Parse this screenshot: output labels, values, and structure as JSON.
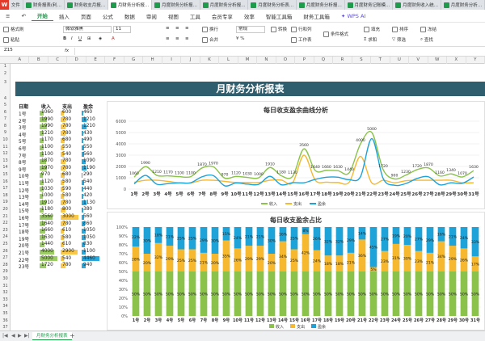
{
  "tabs": [
    {
      "label": "文件"
    },
    {
      "label": "财务报表(利…"
    },
    {
      "label": "财务收支月报…"
    },
    {
      "label": "月财务分析报…"
    },
    {
      "label": "月度财务分析报…"
    },
    {
      "label": "月度财务分析报…"
    },
    {
      "label": "月度财务分析表…"
    },
    {
      "label": "月度财务分析报…"
    },
    {
      "label": "月度财务记账模…"
    },
    {
      "label": "月度财务收入统…"
    },
    {
      "label": "月度财务分析…"
    }
  ],
  "menu": [
    "开始",
    "插入",
    "页面",
    "公式",
    "数据",
    "审阅",
    "视图",
    "工具",
    "会员专享",
    "效率",
    "智能工具箱",
    "财务工具箱"
  ],
  "wps_ai": "WPS AI",
  "ribbon": {
    "format_painter": "格式刷",
    "paste": "粘贴",
    "font_name": "微软雅黑",
    "font_size": "11",
    "wrap": "换行",
    "merge": "合并",
    "number_format": "常规",
    "convert": "转换",
    "row_col": "行和列",
    "worksheet": "工作表",
    "cond_format": "条件格式",
    "fill": "填充",
    "sort": "排序",
    "freeze": "冻结",
    "sum": "求和",
    "filter": "筛选",
    "find": "查找"
  },
  "formula_bar": {
    "cell_ref": "Z15",
    "fx": "fx"
  },
  "columns": [
    "A",
    "B",
    "C",
    "D",
    "E",
    "F",
    "G",
    "H",
    "I",
    "J",
    "K",
    "L",
    "M",
    "N",
    "O",
    "P",
    "Q",
    "R",
    "S",
    "T",
    "U",
    "V",
    "W",
    "X",
    "Y"
  ],
  "rows": [
    "1",
    "2",
    "3",
    "4",
    "5",
    "6",
    "7",
    "8",
    "9",
    "10",
    "11",
    "12",
    "13",
    "14",
    "15",
    "16",
    "17",
    "18",
    "19",
    "20",
    "21",
    "22",
    "23",
    "24",
    "25",
    "26",
    "27",
    "28",
    "29",
    "30",
    "31",
    "32",
    "33",
    "34",
    "35",
    "36",
    "37"
  ],
  "report_title": "月财务分析报表",
  "table": {
    "headers": [
      "日期",
      "收入",
      "支出",
      "盈余"
    ],
    "rows": [
      {
        "date": "1号",
        "income": 1060,
        "expense": 600,
        "surplus": 460
      },
      {
        "date": "2号",
        "income": 1990,
        "expense": 780,
        "surplus": 1210
      },
      {
        "date": "3号",
        "income": 1990,
        "expense": 780,
        "surplus": 1210
      },
      {
        "date": "4号",
        "income": 1210,
        "expense": 780,
        "surplus": 430
      },
      {
        "date": "5号",
        "income": 1170,
        "expense": 680,
        "surplus": 490
      },
      {
        "date": "6号",
        "income": 1100,
        "expense": 550,
        "surplus": 550
      },
      {
        "date": "7号",
        "income": 1100,
        "expense": 540,
        "surplus": 560
      },
      {
        "date": "8号",
        "income": 1870,
        "expense": 780,
        "surplus": 1090
      },
      {
        "date": "9号",
        "income": 1970,
        "expense": 780,
        "surplus": 1190
      },
      {
        "date": "10号",
        "income": 970,
        "expense": 680,
        "surplus": 290
      },
      {
        "date": "11号",
        "income": 1120,
        "expense": 580,
        "surplus": 540
      },
      {
        "date": "12号",
        "income": 1030,
        "expense": 590,
        "surplus": 440
      },
      {
        "date": "13号",
        "income": 1000,
        "expense": 580,
        "surplus": 420
      },
      {
        "date": "14号",
        "income": 1910,
        "expense": 780,
        "surplus": 1130
      },
      {
        "date": "15号",
        "income": 1180,
        "expense": 800,
        "surplus": 380
      },
      {
        "date": "16号",
        "income": 3560,
        "expense": 3000,
        "surplus": 560
      },
      {
        "date": "17号",
        "income": 1640,
        "expense": 780,
        "surplus": 860
      },
      {
        "date": "18号",
        "income": 1660,
        "expense": 610,
        "surplus": 1050
      },
      {
        "date": "19号",
        "income": 1630,
        "expense": 580,
        "surplus": 1050
      },
      {
        "date": "20号",
        "income": 1440,
        "expense": 610,
        "surplus": 830
      },
      {
        "date": "21号",
        "income": 4000,
        "expense": 2900,
        "surplus": 1100
      },
      {
        "date": "22号",
        "income": 5000,
        "expense": 540,
        "surplus": 4460
      },
      {
        "date": "23号",
        "income": 1720,
        "expense": 780,
        "surplus": 940
      }
    ]
  },
  "chart_data": [
    {
      "type": "line",
      "title": "每日收支盈余曲线分析",
      "categories": [
        "1号",
        "2号",
        "3号",
        "4号",
        "5号",
        "6号",
        "7号",
        "8号",
        "9号",
        "10号",
        "11号",
        "12号",
        "13号",
        "14号",
        "15号",
        "16号",
        "17号",
        "18号",
        "19号",
        "20号",
        "21号",
        "22号",
        "23号",
        "24号",
        "25号",
        "26号",
        "27号",
        "28号",
        "29号",
        "30号",
        "31号"
      ],
      "series": [
        {
          "name": "收入",
          "color": "#8bc34a",
          "values": [
            1060,
            1990,
            1210,
            1170,
            1100,
            1100,
            1870,
            1970,
            970,
            1120,
            1030,
            1000,
            1910,
            1180,
            1130,
            3560,
            1640,
            1660,
            1630,
            1440,
            4000,
            5000,
            1720,
            900,
            1230,
            1720,
            1870,
            1160,
            1340,
            1070,
            1630
          ]
        },
        {
          "name": "支出",
          "color": "#f5b82e",
          "values": [
            600,
            780,
            780,
            680,
            550,
            540,
            780,
            780,
            680,
            580,
            590,
            580,
            780,
            800,
            560,
            3000,
            780,
            610,
            580,
            610,
            2900,
            540,
            780,
            560,
            740,
            780,
            780,
            780,
            780,
            560,
            560
          ]
        },
        {
          "name": "盈余",
          "color": "#1ea3d8",
          "values": [
            460,
            1210,
            430,
            490,
            550,
            560,
            1090,
            1190,
            290,
            540,
            440,
            420,
            1130,
            380,
            570,
            560,
            860,
            1050,
            1050,
            830,
            1100,
            4460,
            940,
            340,
            490,
            940,
            1090,
            380,
            560,
            510,
            1070
          ]
        }
      ],
      "point_labels": [
        1060,
        1990,
        1210,
        1170,
        1100,
        1100,
        1870,
        1970,
        970,
        1120,
        1030,
        1000,
        1910,
        1180,
        1130,
        3560,
        1640,
        1660,
        1630,
        1440,
        4000,
        5000,
        1720,
        900,
        1230,
        1720,
        1870,
        1160,
        1340,
        1070,
        1630
      ],
      "ylim": [
        0,
        6000
      ],
      "yticks": [
        0,
        1000,
        2000,
        3000,
        4000,
        5000,
        6000
      ],
      "legend": "bottom",
      "grid": true
    },
    {
      "type": "bar",
      "stacked": "percent",
      "title": "每日收支盈余占比",
      "categories": [
        "1号",
        "2号",
        "3号",
        "4号",
        "5号",
        "6号",
        "7号",
        "8号",
        "9号",
        "10号",
        "11号",
        "12号",
        "13号",
        "14号",
        "15号",
        "16号",
        "17号",
        "18号",
        "19号",
        "20号",
        "21号",
        "22号",
        "23号",
        "24号",
        "25号",
        "26号",
        "27号",
        "28号",
        "29号",
        "30号",
        "31号"
      ],
      "series": [
        {
          "name": "收入",
          "color": "#8bc34a",
          "values": [
            50,
            50,
            50,
            50,
            50,
            50,
            50,
            50,
            50,
            50,
            50,
            50,
            50,
            50,
            50,
            50,
            50,
            50,
            50,
            50,
            50,
            50,
            50,
            50,
            50,
            50,
            50,
            50,
            50,
            50,
            50
          ]
        },
        {
          "name": "支出",
          "color": "#f5b82e",
          "values": [
            28,
            20,
            32,
            29,
            25,
            25,
            21,
            20,
            35,
            26,
            29,
            29,
            20,
            34,
            25,
            42,
            24,
            18,
            18,
            21,
            36,
            5,
            23,
            31,
            30,
            23,
            21,
            34,
            29,
            26,
            17
          ]
        },
        {
          "name": "盈余",
          "color": "#1ea3d8",
          "values": [
            22,
            30,
            18,
            21,
            25,
            25,
            29,
            30,
            15,
            24,
            21,
            21,
            30,
            16,
            25,
            8,
            26,
            32,
            32,
            29,
            14,
            45,
            27,
            19,
            20,
            27,
            29,
            16,
            21,
            24,
            33
          ]
        }
      ],
      "ylim": [
        0,
        100
      ],
      "yticks": [
        "0%",
        "10%",
        "20%",
        "30%",
        "40%",
        "50%",
        "60%",
        "70%",
        "80%",
        "90%",
        "100%"
      ],
      "legend": "bottom"
    }
  ],
  "sheet_tab": "月财务分析报表"
}
